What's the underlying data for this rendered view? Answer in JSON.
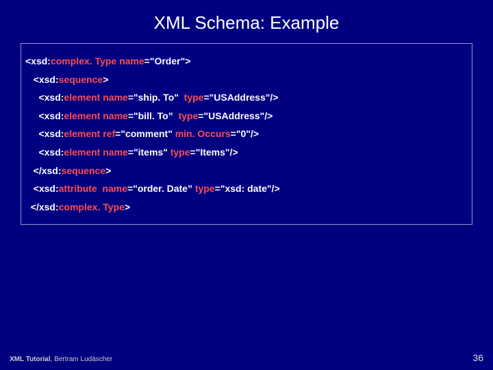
{
  "title": "XML Schema: Example",
  "code": {
    "l1_pre": "<xsd:",
    "l1_kw": "complex. Type",
    "l1_mid": " ",
    "l1_attr": "name",
    "l1_post": "=\"Order\">",
    "l2_pre": "   <xsd:",
    "l2_kw": "sequence",
    "l2_post": ">",
    "l3_pre": "     <xsd:",
    "l3_kw": "element",
    "l3_mid": " ",
    "l3_a1": "name",
    "l3_mid2": "=\"ship. To\"  ",
    "l3_a2": "type",
    "l3_post": "=\"USAddress\"/>",
    "l4_pre": "     <xsd:",
    "l4_kw": "element",
    "l4_mid": " ",
    "l4_a1": "name",
    "l4_mid2": "=\"bill. To”  ",
    "l4_a2": "type",
    "l4_post": "=\"USAddress\"/>",
    "l5_pre": "     <xsd:",
    "l5_kw": "element",
    "l5_mid": " ",
    "l5_a1": "ref",
    "l5_mid2": "=\"comment\" ",
    "l5_a2": "min. Occurs",
    "l5_post": "=\"0\"/>",
    "l6_pre": "     <xsd:",
    "l6_kw": "element",
    "l6_mid": " ",
    "l6_a1": "name",
    "l6_mid2": "=\"items\" ",
    "l6_a2": "type",
    "l6_post": "=\"Items\"/>",
    "l7_pre": "   </xsd:",
    "l7_kw": "sequence",
    "l7_post": ">",
    "l8_pre": "   <xsd:",
    "l8_kw": "attribute",
    "l8_mid": "  ",
    "l8_a1": "name",
    "l8_mid2": "=\"order. Date” ",
    "l8_a2": "type",
    "l8_post": "=\"xsd: date\"/>",
    "l9_pre": "  </xsd:",
    "l9_kw": "complex. Type",
    "l9_post": ">"
  },
  "footer": {
    "tutorial_bold": "XML Tutorial",
    "tutorial_rest": ", Bertram Ludäscher",
    "page": "36"
  }
}
